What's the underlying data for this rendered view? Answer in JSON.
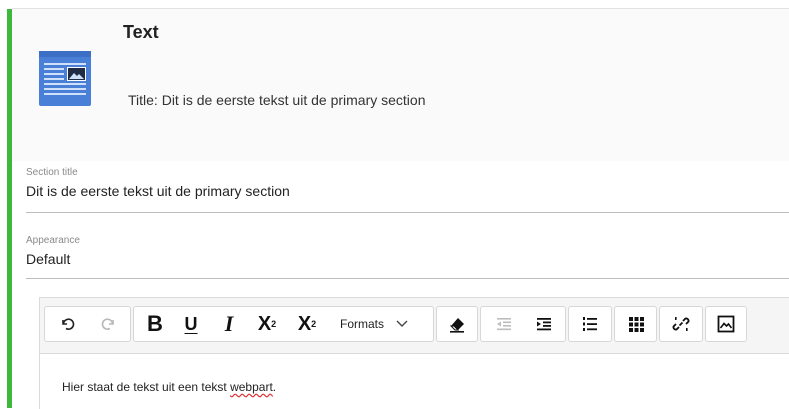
{
  "header": {
    "title": "Text",
    "subtitle": "Title: Dit is de eerste tekst uit de primary section",
    "icon": "text-document-icon",
    "accent_color": "#3db83a",
    "icon_color": "#4a7fd8"
  },
  "fields": {
    "section_title": {
      "label": "Section title",
      "value": "Dit is de eerste tekst uit de primary section"
    },
    "appearance": {
      "label": "Appearance",
      "value": "Default"
    }
  },
  "toolbar": {
    "formats_label": "Formats",
    "buttons": [
      "undo-icon",
      "redo-icon",
      "bold",
      "underline",
      "italic",
      "subscript",
      "superscript",
      "formats",
      "clear-formatting-icon",
      "outdent-icon",
      "indent-icon",
      "numbered-list-icon",
      "table-icon",
      "unlink-icon",
      "image-icon"
    ],
    "bold": "B",
    "underline": "U",
    "italic": "I",
    "subscript": "X",
    "subscript_sub": "2",
    "superscript": "X",
    "superscript_sup": "2"
  },
  "editor": {
    "content_before": "Hier staat de tekst uit een tekst ",
    "content_misspelled": "webpart",
    "content_after": "."
  }
}
